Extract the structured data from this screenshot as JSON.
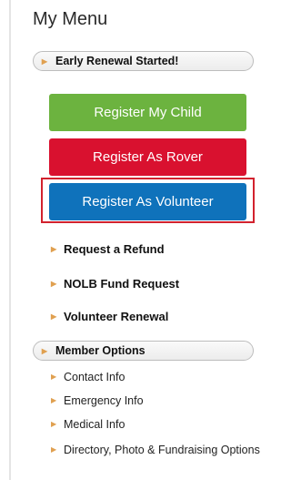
{
  "title": "My Menu",
  "early_renewal": "Early Renewal Started!",
  "buttons": {
    "child": "Register My Child",
    "rover": "Register As Rover",
    "volunteer": "Register As Volunteer"
  },
  "links": [
    "Request a Refund",
    "NOLB Fund Request",
    "Volunteer Renewal"
  ],
  "member_options": {
    "label": "Member Options",
    "items": [
      "Contact Info",
      "Emergency Info",
      "Medical Info",
      "Directory, Photo & Fundraising Options"
    ]
  },
  "colors": {
    "green": "#6cb33f",
    "red": "#d9112f",
    "blue": "#0f72bb",
    "highlight": "#d2222e"
  },
  "icons": {
    "bullet": "caret-right-icon"
  }
}
